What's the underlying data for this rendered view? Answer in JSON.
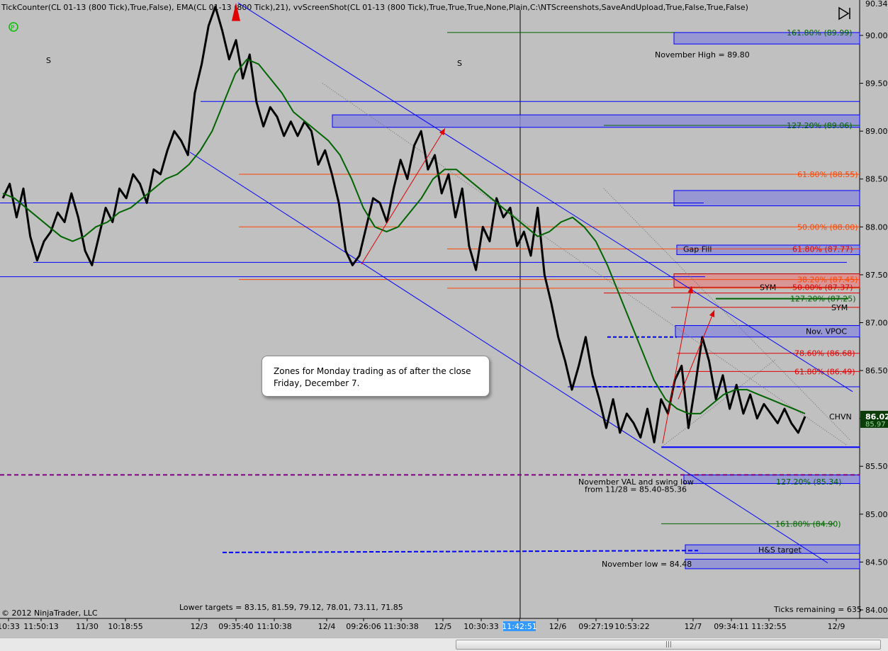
{
  "header": {
    "indicator_text": "TickCounter(CL 01-13 (800 Tick),True,False), EMA(CL 01-13 (800 Tick),21), vvScreenShot(CL 01-13 (800 Tick),True,True,True,None,Plain,C:\\NTScreenshots,SaveAndUpload,True,False,True,False)"
  },
  "callout": {
    "text": "Zones for Monday trading as of after the close Friday, December 7."
  },
  "footer": {
    "copyright": "© 2012 NinjaTrader, LLC",
    "lower_targets": "Lower targets = 83.15, 81.59, 79.12, 78.01, 73.11, 71.85",
    "ticks_remaining": "Ticks remaining = 635"
  },
  "colors": {
    "background": "#c0c0c0",
    "price": "#000000",
    "ema": "#006400",
    "channel": "#0000ff",
    "zone_fill": "#8c8cd8",
    "fib_orange": "#ff4500",
    "fib_red": "#e00000",
    "fib_green": "#006400",
    "vp_purple": "#800080",
    "price_box": "#0a3d0a"
  },
  "chart_data": {
    "type": "line",
    "ylim": [
      84.0,
      90.34
    ],
    "y_ticks": [
      "90.00",
      "89.50",
      "89.00",
      "88.50",
      "88.00",
      "87.50",
      "87.00",
      "86.50",
      "86.00",
      "85.50",
      "85.00",
      "84.50",
      "84.00"
    ],
    "y_top_label": "90.34",
    "x_ticks": [
      "10:33",
      "11:50:13",
      "11/30",
      "10:18:55",
      "12/3",
      "09:35:40",
      "11:10:38",
      "12/4",
      "09:26:06",
      "11:30:38",
      "12/5",
      "10:30:33",
      "11:42:51",
      "12/6",
      "09:27:19",
      "10:53:22",
      "12/7",
      "09:34:11",
      "11:32:55",
      "12/9"
    ],
    "current_price": "86.02",
    "current_price_alt": "85.97",
    "series": [
      {
        "name": "CL 01-13 (800 Tick)",
        "values": [
          88.3,
          88.45,
          88.1,
          88.4,
          87.9,
          87.65,
          87.85,
          87.95,
          88.15,
          88.05,
          88.35,
          88.1,
          87.75,
          87.6,
          87.9,
          88.2,
          88.05,
          88.4,
          88.3,
          88.55,
          88.45,
          88.25,
          88.6,
          88.55,
          88.8,
          89.0,
          88.9,
          88.75,
          89.4,
          89.7,
          90.1,
          90.3,
          90.05,
          89.75,
          89.95,
          89.55,
          89.8,
          89.3,
          89.05,
          89.25,
          89.15,
          88.95,
          89.1,
          88.95,
          89.1,
          89.0,
          88.65,
          88.8,
          88.55,
          88.25,
          87.75,
          87.6,
          87.7,
          88.0,
          88.3,
          88.25,
          88.05,
          88.4,
          88.7,
          88.5,
          88.85,
          89.0,
          88.6,
          88.75,
          88.35,
          88.55,
          88.1,
          88.4,
          87.8,
          87.55,
          88.0,
          87.85,
          88.3,
          88.1,
          88.2,
          87.8,
          87.95,
          87.7,
          88.2,
          87.5,
          87.2,
          86.85,
          86.6,
          86.3,
          86.55,
          86.85,
          86.45,
          86.2,
          85.9,
          86.2,
          85.85,
          86.05,
          85.95,
          85.8,
          86.1,
          85.75,
          86.2,
          86.05,
          86.4,
          86.55,
          85.9,
          86.35,
          86.85,
          86.6,
          86.2,
          86.45,
          86.1,
          86.35,
          86.05,
          86.25,
          86.0,
          86.15,
          86.05,
          85.95,
          86.1,
          85.95,
          85.85,
          86.02
        ]
      },
      {
        "name": "EMA(CL 01-13 (800 Tick),21)",
        "values": [
          88.35,
          88.3,
          88.2,
          88.1,
          88.0,
          87.9,
          87.85,
          87.9,
          88.0,
          88.05,
          88.15,
          88.2,
          88.3,
          88.4,
          88.5,
          88.55,
          88.65,
          88.8,
          89.0,
          89.3,
          89.6,
          89.75,
          89.7,
          89.55,
          89.4,
          89.2,
          89.1,
          89.0,
          88.9,
          88.75,
          88.5,
          88.2,
          88.0,
          87.95,
          88.0,
          88.15,
          88.3,
          88.5,
          88.6,
          88.6,
          88.5,
          88.4,
          88.3,
          88.2,
          88.1,
          88.0,
          87.9,
          87.95,
          88.05,
          88.1,
          88.0,
          87.85,
          87.6,
          87.3,
          87.0,
          86.7,
          86.4,
          86.2,
          86.1,
          86.05,
          86.05,
          86.15,
          86.25,
          86.3,
          86.3,
          86.25,
          86.2,
          86.15,
          86.1,
          86.05
        ]
      }
    ],
    "horizontal_levels": [
      {
        "label": "",
        "value": 90.03
      },
      {
        "label": "November High = 89.80",
        "value": 89.8
      },
      {
        "label": "",
        "value": 89.31
      },
      {
        "label": "127.20% (89.06)",
        "value": 89.06
      },
      {
        "label": "61.80% (88.55)",
        "value": 88.55
      },
      {
        "label": "",
        "value": 88.25
      },
      {
        "label": "50.00% (88.00)",
        "value": 88.0
      },
      {
        "label": "61.80% (87.77)",
        "value": 87.77
      },
      {
        "label": "",
        "value": 87.63
      },
      {
        "label": "38.20% (87.45)",
        "value": 87.45
      },
      {
        "label": "50.00% (87.37)",
        "value": 87.37
      },
      {
        "label": "127.20% (87.25)",
        "value": 87.25
      },
      {
        "label": "78.60% (86.68)",
        "value": 86.68
      },
      {
        "label": "61.80% (86.49)",
        "value": 86.49
      },
      {
        "label": "",
        "value": 86.33
      },
      {
        "label": "127.20% (85.34)",
        "value": 85.34
      },
      {
        "label": "161.80% (84.90)",
        "value": 84.9
      },
      {
        "label": "November low = 84.48",
        "value": 84.48
      }
    ],
    "annotations": [
      "S",
      "S",
      "Gap Fill",
      "SYM",
      "SYM",
      "Nov. VPOC",
      "CHVN",
      "November VAL and swing low",
      "from 11/28 = 85.40-85.36",
      "H&S target",
      "161.80% (89.99)"
    ]
  }
}
